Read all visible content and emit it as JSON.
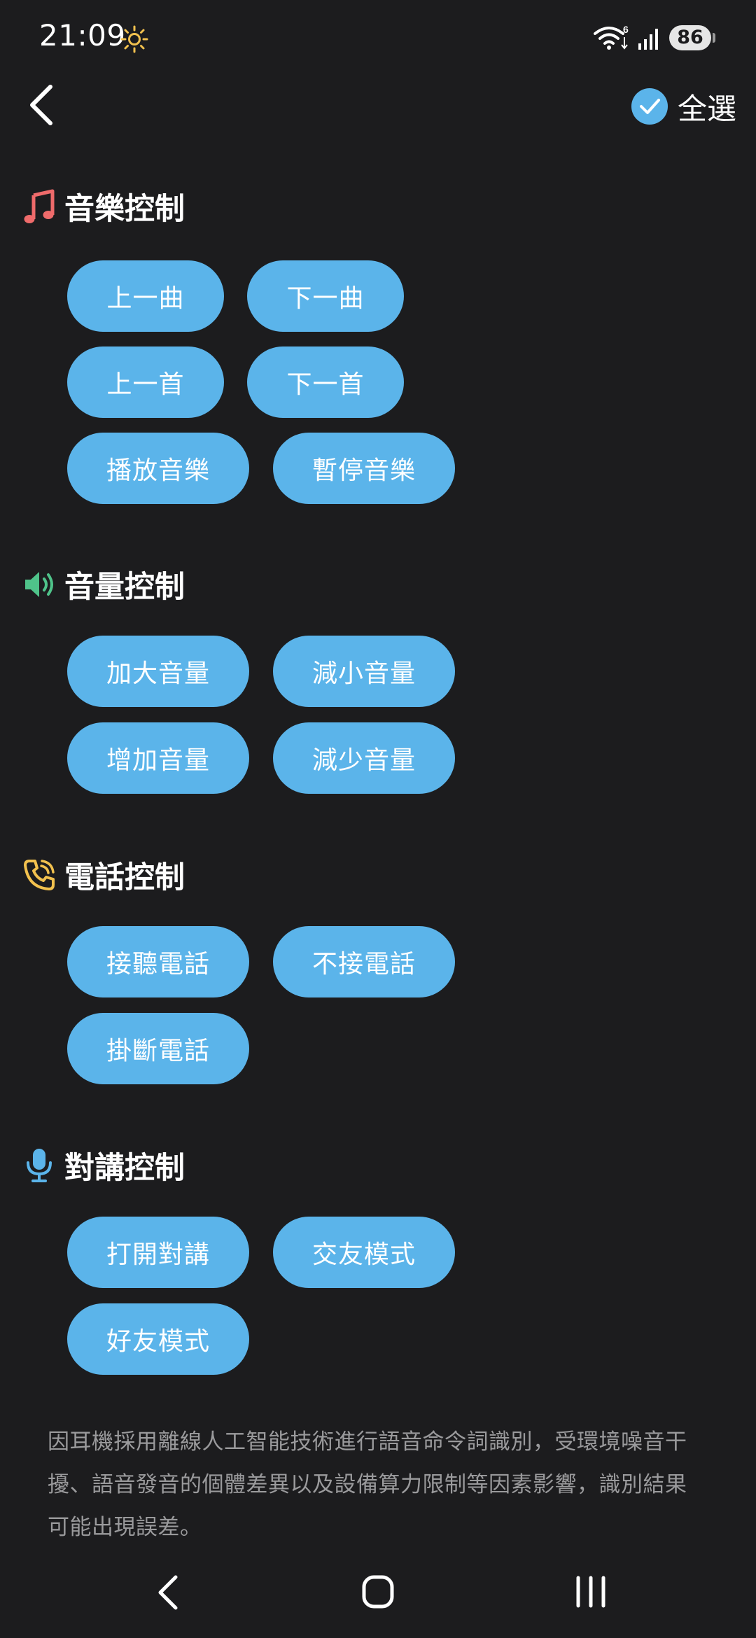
{
  "status_bar": {
    "time": "21:09",
    "weather_icon": "sun-icon",
    "wifi_badge": "6",
    "battery": "86"
  },
  "header": {
    "back_icon": "chevron-left-icon",
    "select_all_label": "全選",
    "select_all_checked": true
  },
  "colors": {
    "background": "#1c1c1e",
    "chip": "#5bb4ea",
    "music_icon": "#ef6b6b",
    "volume_icon": "#4fc38a",
    "phone_icon": "#f2c14e",
    "intercom_icon": "#5bb4ea",
    "disclaimer_text": "#9a9a9c"
  },
  "sections": [
    {
      "title": "音樂控制",
      "icon": "music-note-icon",
      "commands": [
        "上一曲",
        "下一曲",
        "上一首",
        "下一首",
        "播放音樂",
        "暫停音樂"
      ]
    },
    {
      "title": "音量控制",
      "icon": "speaker-icon",
      "commands": [
        "加大音量",
        "減小音量",
        "增加音量",
        "減少音量"
      ]
    },
    {
      "title": "電話控制",
      "icon": "phone-icon",
      "commands": [
        "接聽電話",
        "不接電話",
        "掛斷電話"
      ]
    },
    {
      "title": "對講控制",
      "icon": "microphone-icon",
      "commands": [
        "打開對講",
        "交友模式",
        "好友模式"
      ]
    }
  ],
  "disclaimer": "因耳機採用離線人工智能技術進行語音命令詞識別，受環境噪音干擾、語音發音的個體差異以及設備算力限制等因素影響，識別結果可能出現誤差。",
  "nav_bar": {
    "back_icon": "nav-back-icon",
    "home_icon": "nav-home-icon",
    "recents_icon": "nav-recents-icon"
  }
}
